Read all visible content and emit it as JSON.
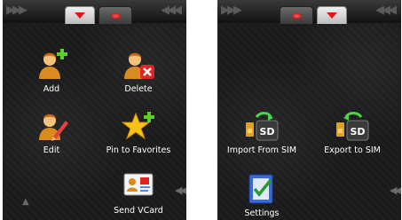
{
  "screens": [
    {
      "name": "Phonebook menu page 1",
      "items": [
        {
          "label": "Add",
          "icon": "add-contact-icon"
        },
        {
          "label": "Delete",
          "icon": "delete-contact-icon"
        },
        {
          "label": "Edit",
          "icon": "edit-contact-icon"
        },
        {
          "label": "Pin to Favorites",
          "icon": "pin-favorites-icon"
        },
        {
          "label": "Send VCard",
          "icon": "vcard-icon"
        }
      ]
    },
    {
      "name": "Phonebook menu page 2",
      "items": [
        {
          "label": "Import From SIM",
          "icon": "import-sim-icon"
        },
        {
          "label": "Export to SIM",
          "icon": "export-sim-icon"
        },
        {
          "label": "Settings",
          "icon": "settings-icon"
        }
      ]
    }
  ],
  "sd_label": "SD",
  "colors": {
    "background": "#1b1b1b",
    "label": "#ffffff",
    "tab_indicator": "#e01818",
    "plus": "#5fcf2a",
    "delete": "#e02424"
  }
}
